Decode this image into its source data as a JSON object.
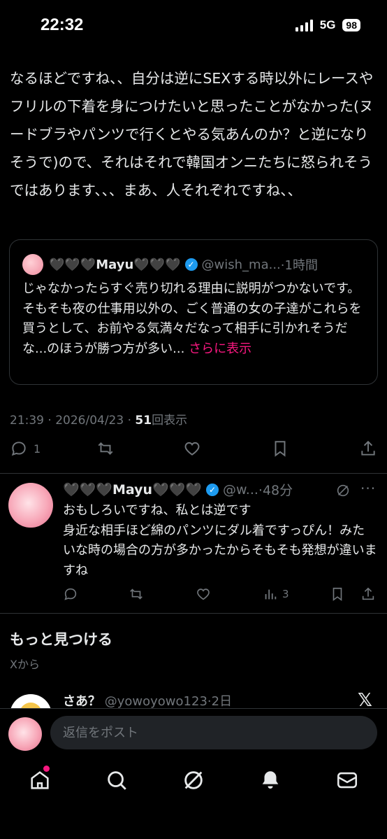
{
  "status": {
    "time": "22:32",
    "network": "5G",
    "battery": "98"
  },
  "post": {
    "text": "なるほどですね、、自分は逆にSEXする時以外にレースやフリルの下着を身につけたいと思ったことがなかった(ヌードブラやパンツで行くとやる気あんのか？と逆になりそうで)ので、それはそれで韓国オンニたちに怒られそうではあります、、、まあ、人それぞれですね、、",
    "quote": {
      "name": "🖤🖤🖤Mayu🖤🖤🖤",
      "handle": "@wish_ma...",
      "time": "·1時間",
      "body": "じゃなかったらすぐ売り切れる理由に説明がつかないです。\nそもそも夜の仕事用以外の、ごく普通の女の子達がこれらを買うとして、お前やる気満々だなって相手に引かれそうだな...のほうが勝つ方が多い...",
      "more": "さらに表示"
    },
    "meta": {
      "datetime": "21:39 · 2026/04/23 · ",
      "views": "51",
      "views_label": "回表示"
    },
    "actions": {
      "reply_count": "1"
    }
  },
  "reply": {
    "name": "🖤🖤🖤Mayu🖤🖤🖤",
    "handle": "@w...",
    "time": "·48分",
    "body": "おもしろいですね、私とは逆です\n身近な相手ほど綿のパンツにダル着ですっぴん！みたいな時の場合の方が多かったからそもそも発想が違いますね",
    "views": "3"
  },
  "discover": {
    "title": "もっと見つける",
    "sub": "Xから"
  },
  "suggested": {
    "name": "さあ？",
    "handle": "@yowoyowo123",
    "time": "·2日"
  },
  "composer": {
    "placeholder": "返信をポスト"
  },
  "colors": {
    "accent": "#f91880",
    "verified": "#1d9bf0",
    "muted": "#71767b"
  }
}
